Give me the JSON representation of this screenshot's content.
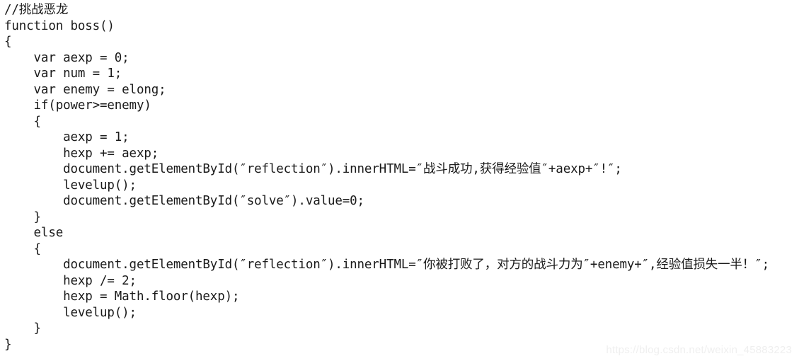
{
  "document": {
    "kind": "code-listing",
    "language": "javascript",
    "background_color": "#ffffff",
    "text_color": "#1a1a1a",
    "indent_unit": "    ",
    "lines": [
      "//挑战恶龙",
      "function boss()",
      "{",
      "    var aexp = 0;",
      "    var num = 1;",
      "    var enemy = elong;",
      "    if(power>=enemy)",
      "    {",
      "        aexp = 1;",
      "        hexp += aexp;",
      "        document.getElementById(″reflection″).innerHTML=″战斗成功,获得经验值″+aexp+″!″;",
      "        levelup();",
      "        document.getElementById(″solve″).value=0;",
      "    }",
      "    else",
      "    {",
      "        document.getElementById(″reflection″).innerHTML=″你被打败了，对方的战斗力为″+enemy+″,经验值损失一半！″;",
      "        hexp /= 2;",
      "        hexp = Math.floor(hexp);",
      "        levelup();",
      "    }",
      "}"
    ]
  },
  "watermark": {
    "text": "https://blog.csdn.net/weixin_45883223",
    "color": "#efefef"
  }
}
